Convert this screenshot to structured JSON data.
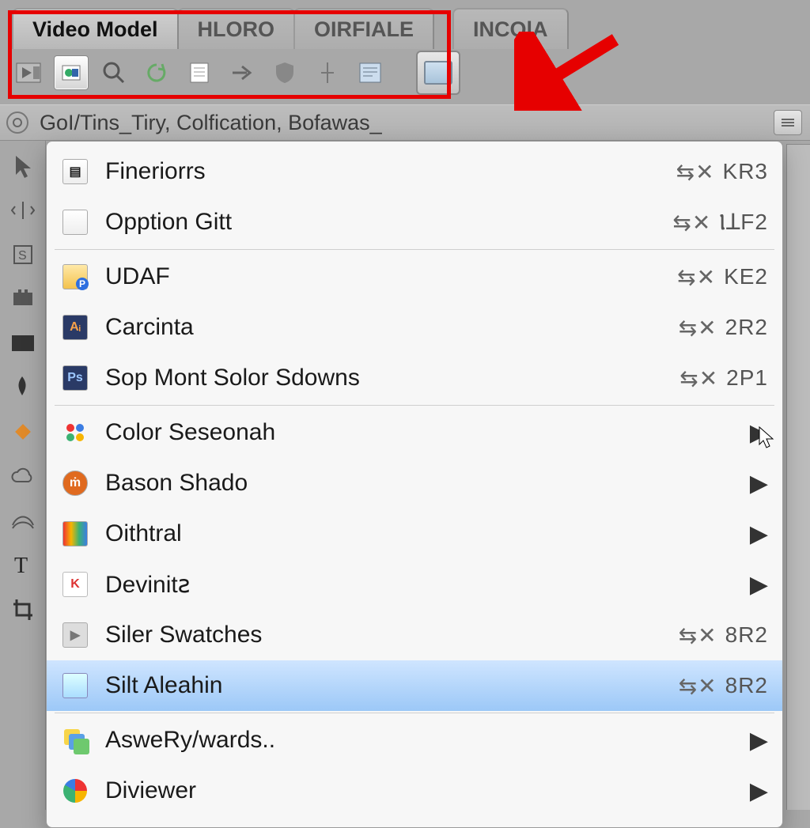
{
  "tabs": [
    {
      "label": "Video Model",
      "active": true
    },
    {
      "label": "HLORO"
    },
    {
      "label": "OIRFIALE"
    },
    {
      "label": "INCOlA",
      "far": true
    }
  ],
  "toolbar": {
    "icons": [
      "media-icon",
      "object-icon",
      "search-icon",
      "refresh-icon",
      "page-icon",
      "arrow-right-icon",
      "shield-icon",
      "divider-icon",
      "script-icon"
    ],
    "selected_index": 1
  },
  "panel_button_name": "panel-toggle-button",
  "path": {
    "text": "GoI/Tins_Tiry, Colfication, Bofawas_"
  },
  "left_tool_icons": [
    "pointer-icon",
    "reflect-icon",
    "swatch-icon",
    "plugin-icon",
    "rectangle-icon",
    "pen-icon",
    "diamond-icon",
    "cloud-icon",
    "warp-icon",
    "type-icon",
    "crop-icon"
  ],
  "menu": {
    "groups": [
      [
        {
          "icon": "file-icon",
          "label": "Fineriorrs",
          "shortcut": "KR3"
        },
        {
          "icon": "blank-file-icon",
          "label": "Opption Gitt",
          "shortcut": "ⲒꓕF2"
        }
      ],
      [
        {
          "icon": "folder-p-icon",
          "label": "UDAF",
          "shortcut": "KE2"
        },
        {
          "icon": "ai-icon",
          "label": "Carcinta",
          "shortcut": "2R2"
        },
        {
          "icon": "ps-icon",
          "label": "Sop Mont Solor Sdowns",
          "shortcut": "2P1"
        }
      ],
      [
        {
          "icon": "color-dots-icon",
          "label": "Color Seseonah",
          "submenu": true
        },
        {
          "icon": "m-icon",
          "label": "Bason Shado",
          "submenu": true
        },
        {
          "icon": "rainbow-icon",
          "label": "Oithtral",
          "submenu": true
        },
        {
          "icon": "k-icon",
          "label": "Devinitꙅ",
          "submenu": true
        },
        {
          "icon": "play-icon",
          "label": "Siler Swatches",
          "shortcut": "8R2"
        },
        {
          "icon": "page-icon",
          "label": "Silt Aleahin",
          "shortcut": "8R2",
          "highlight": true
        }
      ],
      [
        {
          "icon": "stack-icon",
          "label": "AsweRy/wards..",
          "submenu": true
        },
        {
          "icon": "pie-icon",
          "label": "Diviewer",
          "submenu": true
        }
      ]
    ],
    "modifier_glyph": "⇆✕"
  }
}
